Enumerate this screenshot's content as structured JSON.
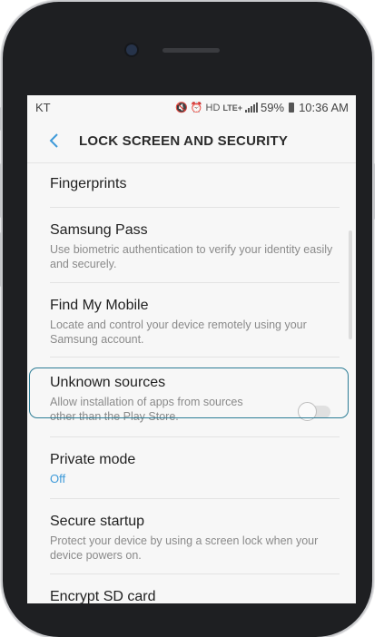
{
  "status_bar": {
    "carrier": "KT",
    "network": "LTE+",
    "battery": "59%",
    "time": "10:36 AM"
  },
  "header": {
    "title": "LOCK SCREEN AND SECURITY"
  },
  "items": [
    {
      "name": "Fingerprints"
    },
    {
      "name": "Samsung Pass",
      "desc": "Use biometric authentication to verify your identity easily and securely."
    },
    {
      "name": "Find My Mobile",
      "desc": "Locate and control your device remotely using your Samsung account."
    },
    {
      "name": "Unknown sources",
      "desc": "Allow installation of apps from sources other than the Play Store.",
      "toggle_on": false
    },
    {
      "name": "Private mode",
      "value": "Off"
    },
    {
      "name": "Secure startup",
      "desc": "Protect your device by using a screen lock when your device powers on."
    },
    {
      "name": "Encrypt SD card"
    }
  ],
  "colors": {
    "accent": "#3e9ad9",
    "highlight_border": "#2d7d96"
  }
}
